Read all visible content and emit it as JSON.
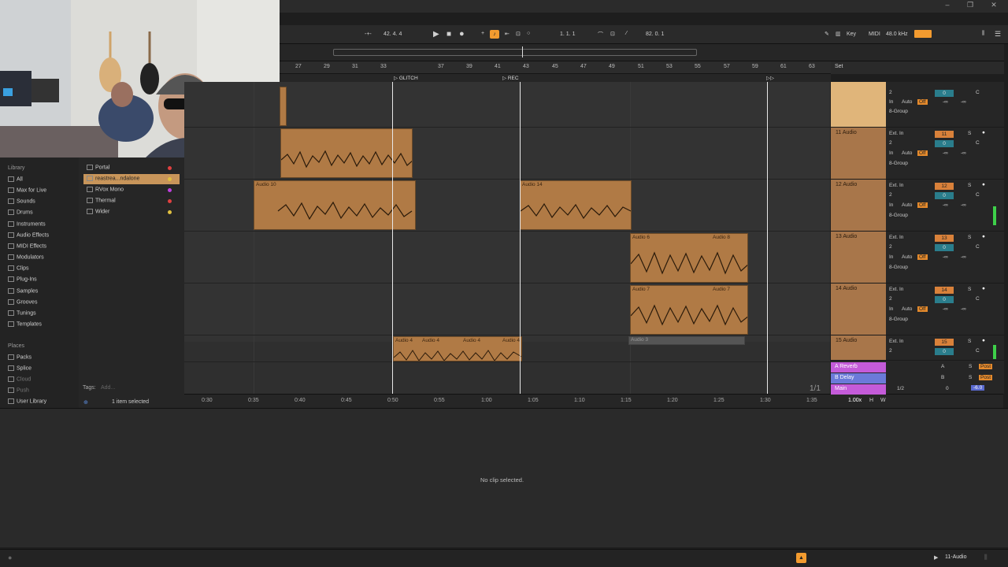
{
  "transport": {
    "arrangement_position": "42.  4.  4",
    "song_position": "1.  1.  1",
    "loop_length": "82.  0.  1"
  },
  "status_right": {
    "key_label": "Key",
    "midi_label": "MIDI",
    "sample_rate": "48.0 kHz"
  },
  "ruler": {
    "bars": [
      "27",
      "29",
      "31",
      "33",
      "37",
      "39",
      "41",
      "43",
      "45",
      "47",
      "49",
      "51",
      "53",
      "55",
      "57",
      "59",
      "61",
      "63"
    ],
    "set_label": "Set"
  },
  "locators": [
    {
      "label": "GLITCH"
    },
    {
      "label": "REC"
    }
  ],
  "clips": [
    {
      "name": "Audio 10"
    },
    {
      "name": "Audio 14"
    },
    {
      "name": "Audio 6"
    },
    {
      "name": "Audio 8"
    },
    {
      "name": "Audio 7"
    },
    {
      "name": "Audio 7"
    },
    {
      "name": "Audio 4"
    },
    {
      "name": "Audio 4"
    },
    {
      "name": "Audio 4"
    },
    {
      "name": "Audio 4"
    },
    {
      "name": "Audio 3"
    }
  ],
  "time_axis": [
    "0:30",
    "0:35",
    "0:40",
    "0:45",
    "0:50",
    "0:55",
    "1:00",
    "1:05",
    "1:10",
    "1:15",
    "1:20",
    "1:25",
    "1:30",
    "1:35"
  ],
  "zoom_fraction": "1/1",
  "tracks": [
    {
      "name": "",
      "input": "Ext. In",
      "channel": "2",
      "number": "",
      "volume": "0",
      "pan": "C",
      "monitor": [
        "In",
        "Auto",
        "Off"
      ],
      "out": "8-Group",
      "send_a": "-∞",
      "send_b": "-∞"
    },
    {
      "name": "11 Audio",
      "input": "Ext. In",
      "channel": "2",
      "number": "11",
      "volume": "0",
      "pan": "C",
      "monitor": [
        "In",
        "Auto",
        "Off"
      ],
      "out": "8-Group",
      "send_a": "-∞",
      "send_b": "-∞"
    },
    {
      "name": "12 Audio",
      "input": "Ext. In",
      "channel": "2",
      "number": "12",
      "volume": "0",
      "pan": "C",
      "monitor": [
        "In",
        "Auto",
        "Off"
      ],
      "out": "8-Group",
      "send_a": "-∞",
      "send_b": "-∞"
    },
    {
      "name": "13 Audio",
      "input": "Ext. In",
      "channel": "2",
      "number": "13",
      "volume": "0",
      "pan": "C",
      "monitor": [
        "In",
        "Auto",
        "Off"
      ],
      "out": "8-Group",
      "send_a": "-∞",
      "send_b": "-∞"
    },
    {
      "name": "14 Audio",
      "input": "Ext. In",
      "channel": "2",
      "number": "14",
      "volume": "0",
      "pan": "C",
      "monitor": [
        "In",
        "Auto",
        "Off"
      ],
      "out": "8-Group",
      "send_a": "-∞",
      "send_b": "-∞"
    },
    {
      "name": "15 Audio",
      "input": "Ext. In",
      "channel": "2",
      "number": "15",
      "volume": "0",
      "pan": "C",
      "monitor": [],
      "out": "",
      "send_a": "",
      "send_b": ""
    }
  ],
  "returns": [
    {
      "name": "A Reverb",
      "color": "#c45bd9",
      "letter": "A",
      "post": "Post"
    },
    {
      "name": "B Delay",
      "color": "#6b7ad9",
      "letter": "B",
      "post": "Post"
    },
    {
      "name": "Main",
      "color": "#c45bd9",
      "letter": "",
      "post": "-6.0",
      "ratio": "1/2",
      "volume": "0"
    }
  ],
  "master_bottom": {
    "tempo_scale": "1.00x",
    "h": "H",
    "w": "W"
  },
  "sidebar": {
    "title": "Library",
    "items": [
      "All",
      "Max for Live",
      "Sounds",
      "Drums",
      "Instruments",
      "Audio Effects",
      "MIDI Effects",
      "Modulators",
      "Clips",
      "Plug-Ins",
      "Samples",
      "Grooves",
      "Tunings",
      "Templates"
    ],
    "places_title": "Places",
    "places": [
      "Packs",
      "Splice",
      "Cloud",
      "Push",
      "User Library"
    ]
  },
  "browser": {
    "items": [
      {
        "name": "Portal",
        "color": "#e04040"
      },
      {
        "name": "reastrea...ndalone",
        "color": "#e0c040",
        "selected": true
      },
      {
        "name": "RVox Mono",
        "color": "#c040e0"
      },
      {
        "name": "Thermal",
        "color": "#e04040"
      },
      {
        "name": "Wider",
        "color": "#e0c040"
      }
    ],
    "tags_label": "Tags:",
    "tags_placeholder": "Add...",
    "selection_info": "1 item selected"
  },
  "detail": {
    "message": "No clip selected."
  },
  "statusbar": {
    "selected_track": "11-Audio"
  },
  "colors": {
    "clip": "#b07a45",
    "accent": "#f39b2f",
    "track": "#a8764a"
  }
}
